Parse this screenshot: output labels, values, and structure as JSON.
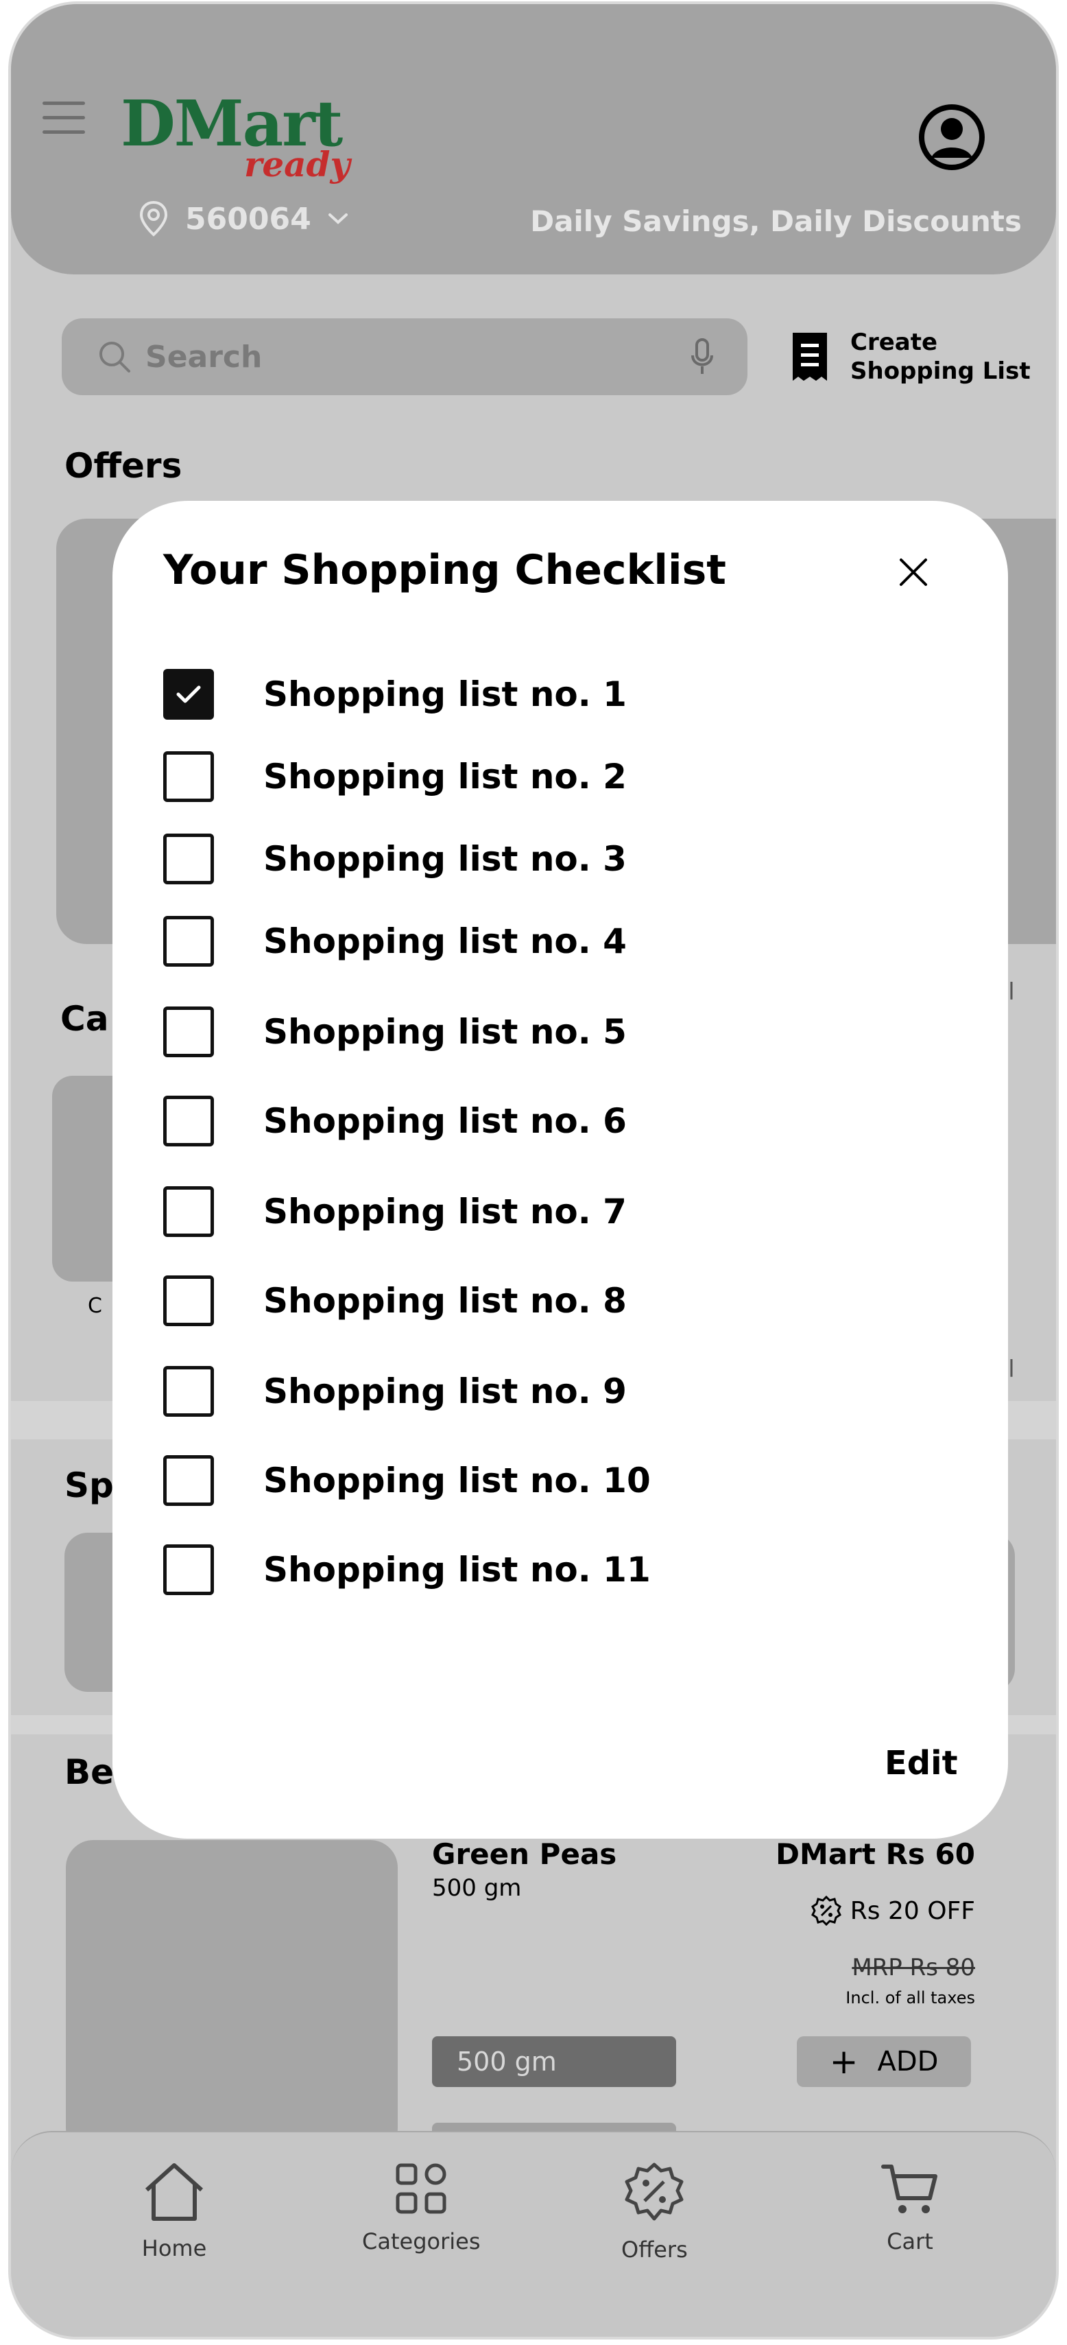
{
  "header": {
    "brand_main": "DMart",
    "brand_sub": "ready",
    "pincode": "560064",
    "tagline": "Daily Savings, Daily Discounts"
  },
  "search": {
    "placeholder": "Search"
  },
  "create_list": {
    "line1": "Create",
    "line2": "Shopping List"
  },
  "sections": {
    "offers": "Offers",
    "categories_partial": "Ca",
    "category_label_partial": "C",
    "view_all_partial_1": "all",
    "view_all_partial_2": "all",
    "special_partial": "Sp",
    "best_partial": "Be"
  },
  "product": {
    "name": "Green Peas",
    "weight": "500 gm",
    "price": "DMart Rs 60",
    "discount": "Rs 20 OFF",
    "mrp": "MRP Rs 80",
    "tax_note": "Incl. of all taxes",
    "weight_option": "500 gm",
    "add_label": "ADD"
  },
  "bottom_nav": {
    "items": [
      {
        "label": "Home",
        "icon": "home-icon"
      },
      {
        "label": "Categories",
        "icon": "categories-icon"
      },
      {
        "label": "Offers",
        "icon": "offers-badge-icon"
      },
      {
        "label": "Cart",
        "icon": "cart-icon"
      }
    ]
  },
  "modal": {
    "title": "Your Shopping Checklist",
    "edit_label": "Edit",
    "items": [
      {
        "label": "Shopping list no. 1",
        "checked": true
      },
      {
        "label": "Shopping list no. 2",
        "checked": false
      },
      {
        "label": "Shopping list no. 3",
        "checked": false
      },
      {
        "label": "Shopping list no. 4",
        "checked": false
      },
      {
        "label": "Shopping list no. 5",
        "checked": false
      },
      {
        "label": "Shopping list no. 6",
        "checked": false
      },
      {
        "label": "Shopping list no. 7",
        "checked": false
      },
      {
        "label": "Shopping list no. 8",
        "checked": false
      },
      {
        "label": "Shopping list no. 9",
        "checked": false
      },
      {
        "label": "Shopping list no. 10",
        "checked": false
      },
      {
        "label": "Shopping list no. 11",
        "checked": false
      }
    ]
  },
  "colors": {
    "header_bg": "#a3a3a3",
    "page_bg": "#c9c9c9",
    "brand_green": "#1d6b3a",
    "brand_red": "#c62d2d",
    "modal_bg": "#ffffff"
  }
}
